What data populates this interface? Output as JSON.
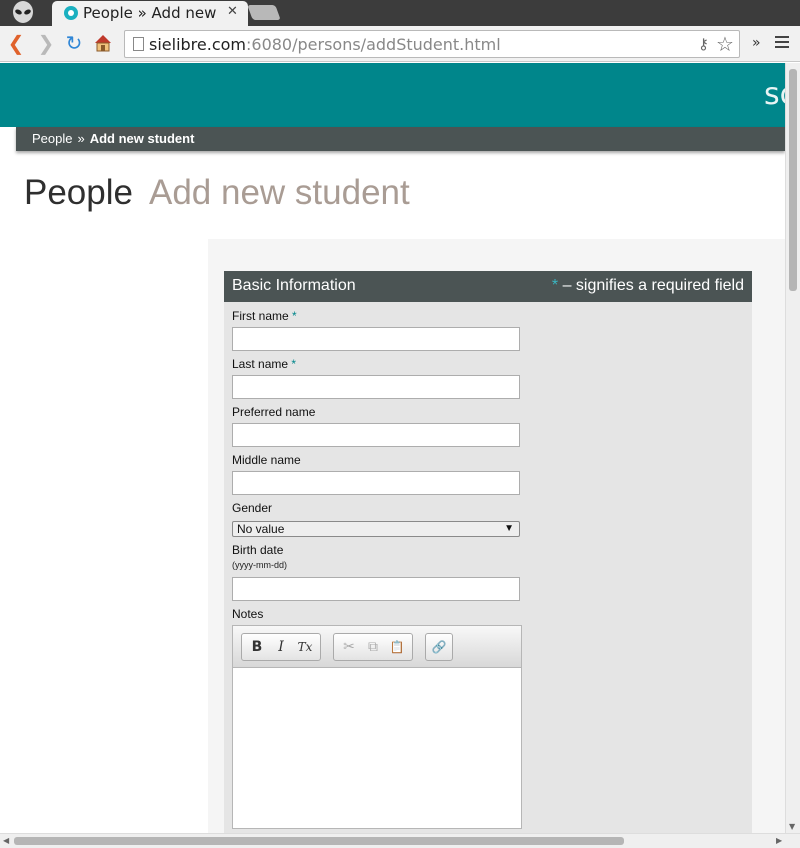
{
  "browser": {
    "tab_title": "People » Add new st",
    "tab_close": "✕",
    "url_host": "sielibre.com",
    "url_rest": ":6080/persons/addStudent.html",
    "overflow_label": "»"
  },
  "site": {
    "logo_text": "sc"
  },
  "breadcrumb": {
    "items": [
      "People",
      "Add new student"
    ],
    "separator": "»"
  },
  "heading": {
    "main": "People",
    "sub": "Add new student"
  },
  "form": {
    "title": "Basic Information",
    "required_star": "*",
    "required_note": "– signifies a required field",
    "fields": {
      "first_name": {
        "label": "First name",
        "required": "*",
        "value": ""
      },
      "last_name": {
        "label": "Last name",
        "required": "*",
        "value": ""
      },
      "preferred_name": {
        "label": "Preferred name",
        "value": ""
      },
      "middle_name": {
        "label": "Middle name",
        "value": ""
      },
      "gender": {
        "label": "Gender",
        "selected": "No value",
        "arrow": "▼"
      },
      "birth_date": {
        "label": "Birth date",
        "hint": "(yyyy-mm-dd)",
        "value": ""
      },
      "notes": {
        "label": "Notes"
      }
    },
    "editor_buttons": {
      "bold": "B",
      "italic": "I",
      "clear_format": "Tx",
      "cut": "✂",
      "copy": "⧉",
      "paste": "📋",
      "link": "🔗"
    }
  },
  "colors": {
    "banner": "#00868b",
    "header_bar": "#4b5454",
    "required_star": "#3ab6c1",
    "subheading": "#a99c94"
  }
}
